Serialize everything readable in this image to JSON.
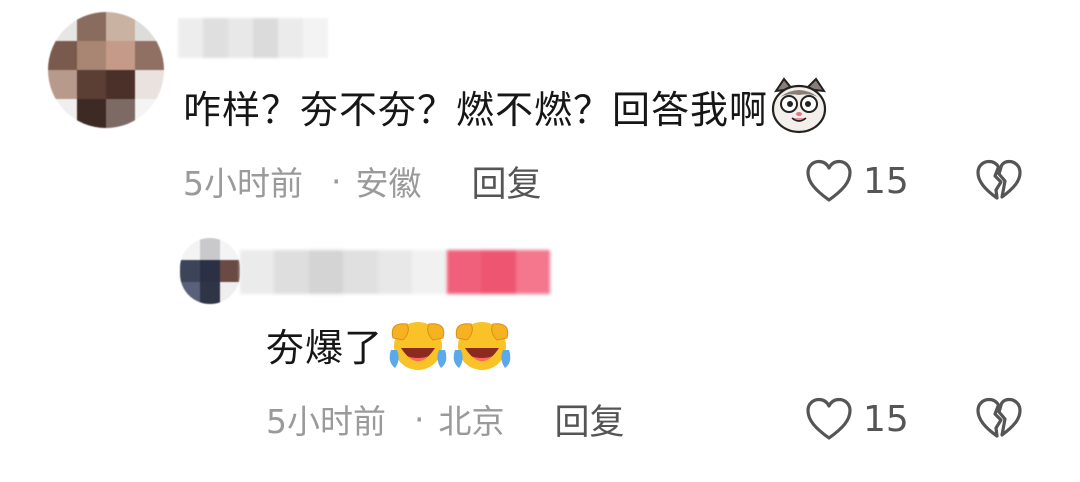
{
  "comment": {
    "text": "咋样？夯不夯？燃不燃？回答我啊",
    "emoji": "cat-face-sticker",
    "time": "5小时前",
    "dot": "·",
    "location": "安徽",
    "reply_label": "回复",
    "likes": "15"
  },
  "reply": {
    "text": "夯爆了",
    "emoji": "crying-laughing-face",
    "time": "5小时前",
    "dot": "·",
    "location": "北京",
    "reply_label": "回复",
    "likes": "15"
  },
  "icons": {
    "like": "heart-outline-icon",
    "dislike": "broken-heart-icon"
  },
  "colors": {
    "text_primary": "#161616",
    "text_meta": "#9a9a9a",
    "text_action": "#555555",
    "redacted_pink": "#f0607a"
  }
}
